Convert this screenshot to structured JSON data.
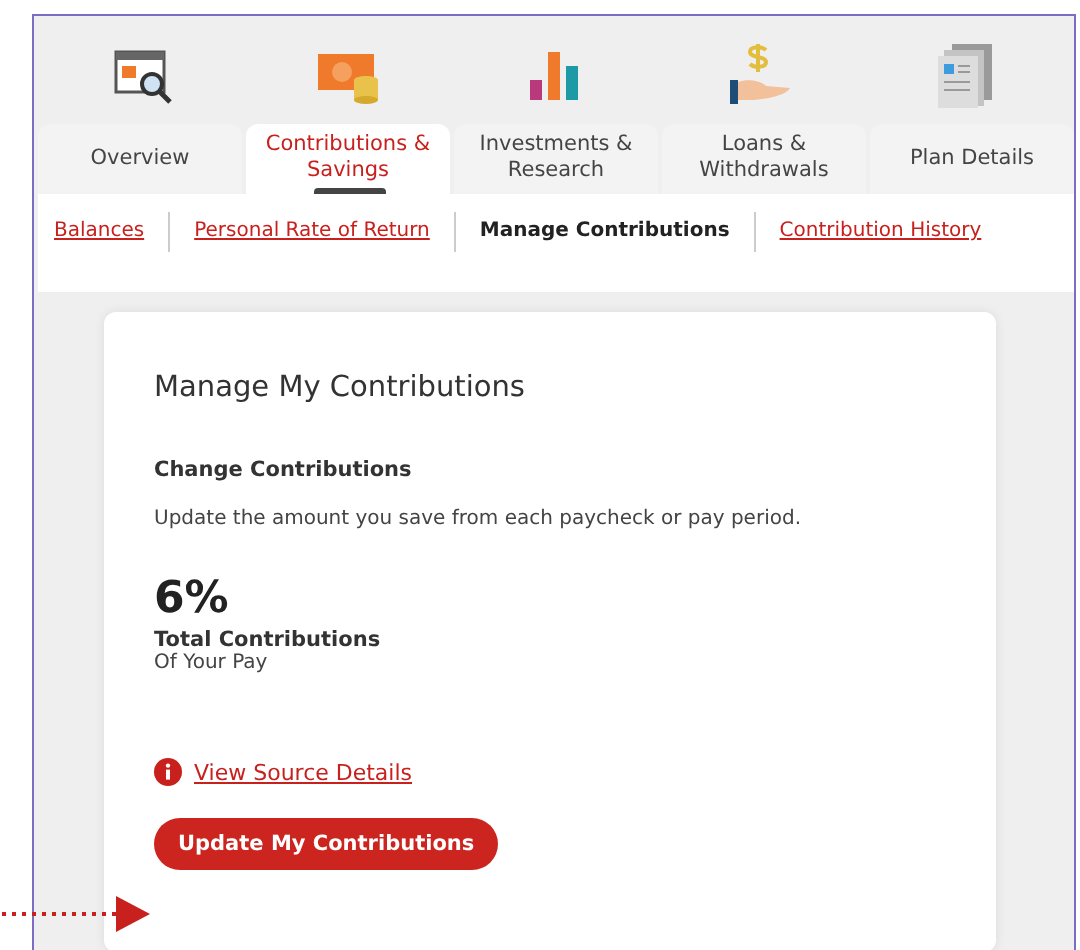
{
  "tabs": [
    {
      "label": "Overview",
      "kind": "overview",
      "selected": false
    },
    {
      "label": "Contributions & Savings",
      "kind": "savings",
      "selected": true
    },
    {
      "label": "Investments & Research",
      "kind": "investments",
      "selected": false
    },
    {
      "label": "Loans & Withdrawals",
      "kind": "loans",
      "selected": false
    },
    {
      "label": "Plan Details",
      "kind": "plan",
      "selected": false
    }
  ],
  "subnav": [
    {
      "label": "Balances",
      "selected": false
    },
    {
      "label": "Personal Rate of Return",
      "selected": false
    },
    {
      "label": "Manage Contributions",
      "selected": true
    },
    {
      "label": "Contribution History",
      "selected": false
    }
  ],
  "card": {
    "title": "Manage My Contributions",
    "section_title": "Change Contributions",
    "description": "Update the amount you save from each paycheck or pay period.",
    "total": "6%",
    "total_label": "Total Contributions",
    "total_sublabel": "Of Your Pay",
    "details_link": "View Source Details",
    "button": "Update My Contributions"
  }
}
